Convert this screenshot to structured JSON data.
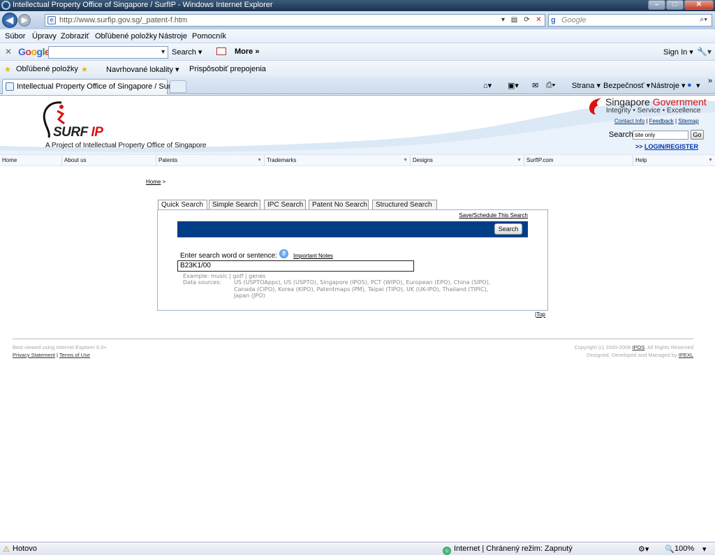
{
  "window": {
    "title": "Intellectual Property Office of Singapore / SurfIP - Windows Internet Explorer",
    "minimize": "–",
    "maximize": "□",
    "close": "✕"
  },
  "address_bar": {
    "url": "http://www.surfip.gov.sg/_patent-f.htm",
    "google_placeholder": "Google"
  },
  "menu": [
    "Súbor",
    "Úpravy",
    "Zobraziť",
    "Obľúbené položky",
    "Nástroje",
    "Pomocník"
  ],
  "google_toolbar": {
    "close": "✕",
    "logo_letters": [
      "G",
      "o",
      "o",
      "g",
      "l",
      "e"
    ],
    "search_label": "Search ▾",
    "more_label": "More »",
    "sign_in_label": "Sign In ▾"
  },
  "favorites_bar": {
    "favorites_label": "Obľúbené položky",
    "suggested_label": "Navrhované lokality ▾",
    "customize_label": "Prispôsobiť prepojenia"
  },
  "tabs": {
    "active_label": "Intellectual Property Office of Singapore / SurfIP"
  },
  "command_bar": {
    "page_label": "Strana ▾",
    "safety_label": "Bezpečnosť ▾",
    "tools_label": "Nástroje ▾",
    "help_label": "▾",
    "chevron": "»"
  },
  "site": {
    "logo_name_a": "SURF",
    "logo_name_b": " IP",
    "tagline": "A Project of Intellectual Property Office of Singapore",
    "gov_name_a": "Singapore ",
    "gov_name_b": "Government",
    "gov_tagline": "Integrity  •  Service  •  Excellence",
    "top_links": [
      "Contact Info",
      "Feedback",
      "Sitemap"
    ],
    "site_search_label": "Search",
    "site_search_value": "site only",
    "go_label": "Go",
    "login_arrows": ">>",
    "login_label": "LOGIN/REGISTER"
  },
  "nav": [
    {
      "label": "Home",
      "dropdown": false
    },
    {
      "label": "About us",
      "dropdown": false
    },
    {
      "label": "Patents",
      "dropdown": true
    },
    {
      "label": "Trademarks",
      "dropdown": true
    },
    {
      "label": "Designs",
      "dropdown": true
    },
    {
      "label": "SurfIP.com",
      "dropdown": false
    },
    {
      "label": "Help",
      "dropdown": true
    }
  ],
  "breadcrumb": {
    "home": "Home",
    "sep": ">"
  },
  "search_tabs": [
    "Quick Search",
    "Simple Search",
    "IPC Search",
    "Patent No Search",
    "Structured Search"
  ],
  "search_panel": {
    "save_link": "Save/Schedule This Search",
    "search_button": "Search",
    "enter_label": "Enter search word or sentence:",
    "help_glyph": "?",
    "notes_link": "Important Notes",
    "query_value": "B23K1/00",
    "example_text": "Example: music | golf | genes",
    "data_sources_label": "Data sources:",
    "data_sources_text": "US (USPTOApps), US (USPTO), Singapore (IPOS), PCT (WIPO), European (EPO), China (SIPO), Canada (CIPO), Korea (KIPO), Patentmaps (PM), Taipei (TIPO), UK (UK-IPO), Thailand (TIPIC), Japan (JPO)"
  },
  "top_link": {
    "sep": "|",
    "label": "Top"
  },
  "footer": {
    "best_viewed": "Best viewed using Internet Explorer 6.0+",
    "privacy": "Privacy Statement",
    "terms": "Terms of Use",
    "copyright_prefix": "Copyright (c) 2000-2008 ",
    "copyright_link": "IPOS",
    "copyright_suffix": ". All Rights Reserved",
    "managed_prefix": "Designed, Developed and Managed by ",
    "managed_link": "IPEXL"
  },
  "status_bar": {
    "status": "Hotovo",
    "zone": "Internet | Chránený režim: Zapnutý",
    "zoom": "100%"
  },
  "colors": {
    "brand_blue": "#003e86",
    "brand_red": "#dd1111"
  }
}
